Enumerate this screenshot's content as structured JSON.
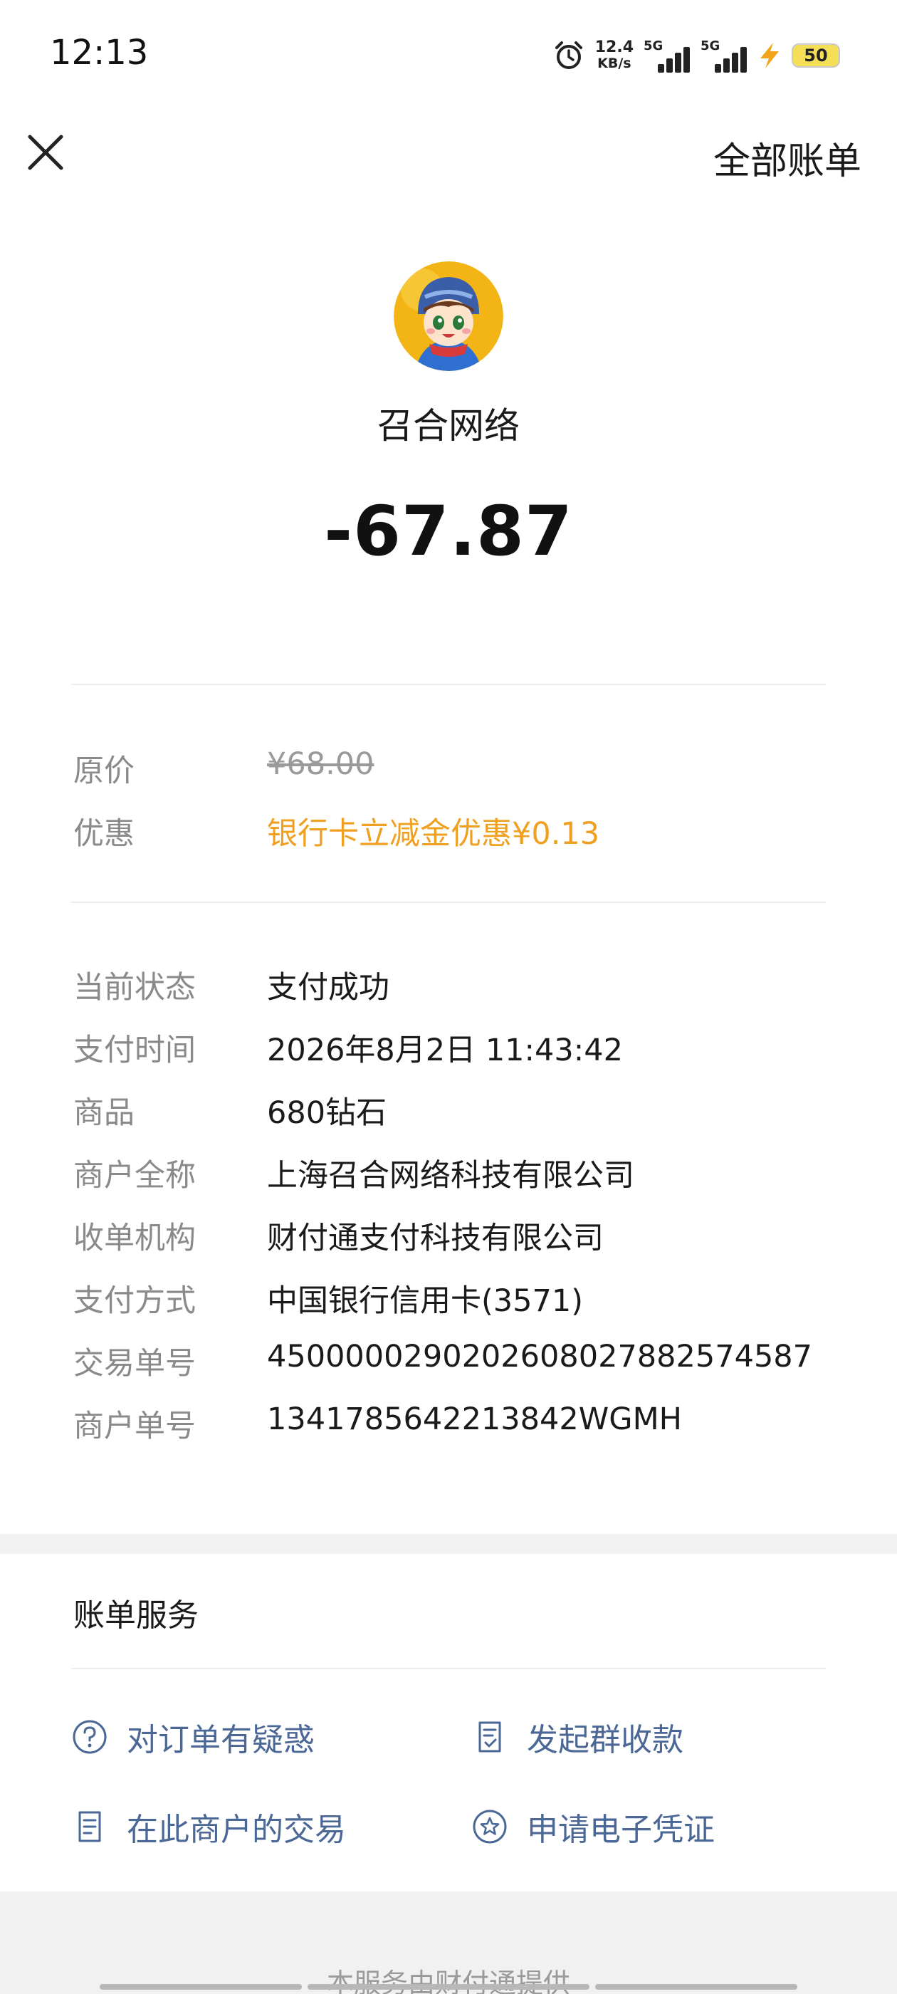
{
  "status_bar": {
    "time": "12:13",
    "net_speed_value": "12.4",
    "net_speed_unit": "KB/s",
    "sim1_label": "5G",
    "sim2_label": "5G",
    "battery": "50"
  },
  "header": {
    "close_icon": "close-icon",
    "all_bills_label": "全部账单"
  },
  "merchant": {
    "avatar_icon": "merchant-avatar",
    "name": "召合网络",
    "amount": "-67.87"
  },
  "pricing": {
    "original_price_label": "原价",
    "original_price_value": "¥68.00",
    "discount_label": "优惠",
    "discount_value": "银行卡立减金优惠¥0.13",
    "discount_color": "#f0a020"
  },
  "details": [
    {
      "label": "当前状态",
      "value": "支付成功"
    },
    {
      "label": "支付时间",
      "value": "2026年8月2日 11:43:42"
    },
    {
      "label": "商品",
      "value": "680钻石"
    },
    {
      "label": "商户全称",
      "value": "上海召合网络科技有限公司"
    },
    {
      "label": "收单机构",
      "value": "财付通支付科技有限公司"
    },
    {
      "label": "支付方式",
      "value": "中国银行信用卡(3571)"
    },
    {
      "label": "交易单号",
      "value": "4500000290202608027882574587"
    },
    {
      "label": "商户单号",
      "value": "1341785642213842WGMH"
    }
  ],
  "bill_service": {
    "title": "账单服务",
    "link_color": "#4a6795",
    "items": [
      {
        "label": "对订单有疑惑",
        "icon": "question-circle-icon"
      },
      {
        "label": "发起群收款",
        "icon": "group-collect-icon"
      },
      {
        "label": "在此商户的交易",
        "icon": "document-list-icon"
      },
      {
        "label": "申请电子凭证",
        "icon": "star-badge-icon"
      }
    ]
  },
  "footer": {
    "text": "本服务由财付通提供"
  }
}
